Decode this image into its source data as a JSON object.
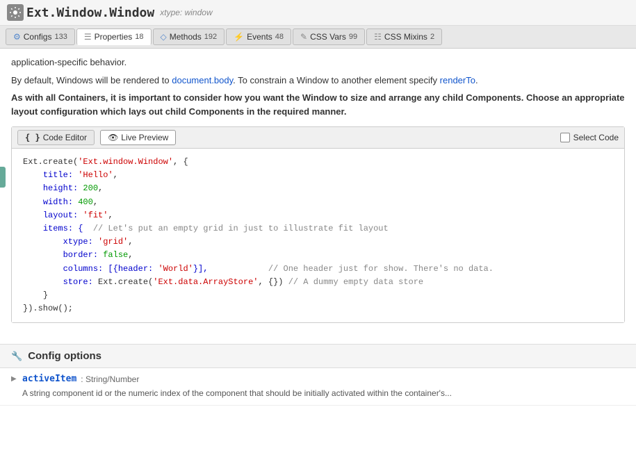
{
  "header": {
    "icon": "gear-icon",
    "title": "Ext.Window.Window",
    "xtype_label": "xtype: window"
  },
  "nav": {
    "tabs": [
      {
        "id": "configs",
        "icon": "configs-icon",
        "icon_char": "⚙",
        "label": "Configs",
        "count": "133"
      },
      {
        "id": "properties",
        "icon": "properties-icon",
        "icon_char": "☰",
        "label": "Properties",
        "count": "18",
        "active": true
      },
      {
        "id": "methods",
        "icon": "methods-icon",
        "icon_char": "◇",
        "label": "Methods",
        "count": "192"
      },
      {
        "id": "events",
        "icon": "events-icon",
        "icon_char": "⚡",
        "label": "Events",
        "count": "48"
      },
      {
        "id": "css-vars",
        "icon": "css-vars-icon",
        "icon_char": "✎",
        "label": "CSS Vars",
        "count": "99"
      },
      {
        "id": "css-mixins",
        "icon": "css-mixins-icon",
        "icon_char": "☷",
        "label": "CSS Mixins",
        "count": "2"
      }
    ]
  },
  "content": {
    "paragraph1": "application-specific behavior.",
    "paragraph2_start": "By default, Windows will be rendered to ",
    "paragraph2_link1": "document.body",
    "paragraph2_mid": ". To constrain a Window to another element specify ",
    "paragraph2_link2": "renderTo",
    "paragraph2_end": ".",
    "paragraph3": "As with all Containers, it is important to consider how you want the Window to size and arrange any child Components. Choose an appropriate layout configuration which lays out child Components in the required manner."
  },
  "code_toolbar": {
    "code_editor_label": "{ } Code Editor",
    "live_preview_label": "👁 Live Preview",
    "select_code_label": "Select Code"
  },
  "code": {
    "lines": [
      "Ext.create('Ext.window.Window', {",
      "    title: 'Hello',",
      "    height: 200,",
      "    width: 400,",
      "    layout: 'fit',",
      "    items: {  // Let's put an empty grid in just to illustrate fit layout",
      "        xtype: 'grid',",
      "        border: false,",
      "        columns: [{header: 'World'}],            // One header just for show. There's no data.",
      "        store: Ext.create('Ext.data.ArrayStore', {}) // A dummy empty data store",
      "    }",
      "}).show();"
    ]
  },
  "config_options": {
    "title": "Config options",
    "icon_char": "🔧",
    "items": [
      {
        "name": "activeItem",
        "separator": " : ",
        "type": "String/Number",
        "description": "A string component id or the numeric index of the component that should be initially activated within the container's..."
      }
    ]
  }
}
